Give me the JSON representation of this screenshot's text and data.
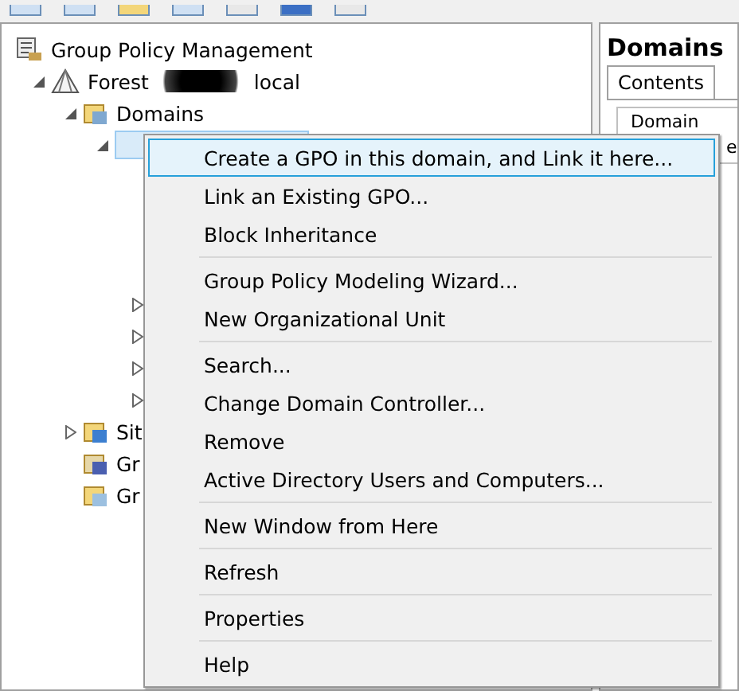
{
  "tree": {
    "root": {
      "label": "Group Policy Management",
      "children": [
        {
          "label_start": "Forest",
          "label_end": "local",
          "expanded": true,
          "children": [
            {
              "label": "Domains",
              "expanded": true,
              "children": [
                {
                  "expanded": true,
                  "selected": true,
                  "children": [
                    {
                      "expanded": false
                    },
                    {
                      "expanded": false
                    },
                    {
                      "expanded": false
                    },
                    {
                      "expanded": false
                    }
                  ]
                }
              ]
            },
            {
              "label": "Sit",
              "kind": "sites",
              "expanded": false
            },
            {
              "label": "Gr",
              "kind": "modeling"
            },
            {
              "label": "Gr",
              "kind": "results"
            }
          ]
        }
      ]
    }
  },
  "details": {
    "title": "Domains",
    "tabs": [
      {
        "label": "Contents",
        "selected": true
      }
    ],
    "column_1": "Domain",
    "column_2": "e"
  },
  "context_menu": {
    "groups": [
      [
        {
          "label": "Create a GPO in this domain, and Link it here...",
          "selected": true
        },
        {
          "label": "Link an Existing GPO...",
          "selected": false
        },
        {
          "label": "Block Inheritance",
          "selected": false
        }
      ],
      [
        {
          "label": "Group Policy Modeling Wizard...",
          "selected": false
        },
        {
          "label": "New Organizational Unit",
          "selected": false
        }
      ],
      [
        {
          "label": "Search...",
          "selected": false
        },
        {
          "label": "Change Domain Controller...",
          "selected": false
        },
        {
          "label": "Remove",
          "selected": false
        },
        {
          "label": "Active Directory Users and Computers...",
          "selected": false
        }
      ],
      [
        {
          "label": "New Window from Here",
          "selected": false
        }
      ],
      [
        {
          "label": "Refresh",
          "selected": false
        }
      ],
      [
        {
          "label": "Properties",
          "selected": false
        }
      ],
      [
        {
          "label": "Help",
          "selected": false
        }
      ]
    ]
  }
}
